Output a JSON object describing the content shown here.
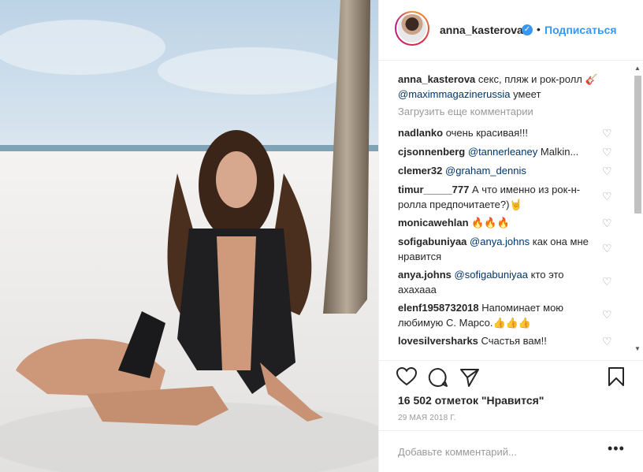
{
  "post": {
    "username": "anna_kasterova",
    "follow_label": "Подписаться",
    "caption_user": "anna_kasterova",
    "caption_text": "секс, пляж и рок-ролл 🎸",
    "caption_mention": "@maximmagazinerussia",
    "caption_tail": "умеет",
    "load_more": "Загрузить еще комментарии",
    "likes": "16 502 отметок \"Нравится\"",
    "date": "29 МАЯ 2018 Г.",
    "add_comment_placeholder": "Добавьте комментарий...",
    "options": "•••"
  },
  "comments": [
    {
      "user": "nadlanko",
      "mention": "",
      "text": "очень красивая!!!"
    },
    {
      "user": "cjsonnenberg",
      "mention": "@tannerleaney",
      "text": "Malkin..."
    },
    {
      "user": "clemer32",
      "mention": "@graham_dennis",
      "text": ""
    },
    {
      "user": "timur_____777",
      "mention": "",
      "text": "А что именно из рок-н-ролла предпочитаете?)🤘"
    },
    {
      "user": "monicawehlan",
      "mention": "",
      "text": "🔥🔥🔥"
    },
    {
      "user": "sofigabuniyaa",
      "mention": "@anya.johns",
      "text": "как она мне нравится"
    },
    {
      "user": "anya.johns",
      "mention": "@sofigabuniyaa",
      "text": "кто это ахахааа"
    },
    {
      "user": "elenf1958732018",
      "mention": "",
      "text": "Напоминает мою любимую С. Марсо.👍👍👍"
    },
    {
      "user": "lovesilversharks",
      "mention": "",
      "text": "Счастья вам!!"
    }
  ],
  "icons": {
    "verified": "verified-badge-icon",
    "heart": "heart-icon",
    "comment": "comment-icon",
    "share": "share-icon",
    "bookmark": "bookmark-icon"
  },
  "colors": {
    "accent": "#3897f0",
    "text": "#262626",
    "muted": "#999999",
    "border": "#efefef"
  }
}
